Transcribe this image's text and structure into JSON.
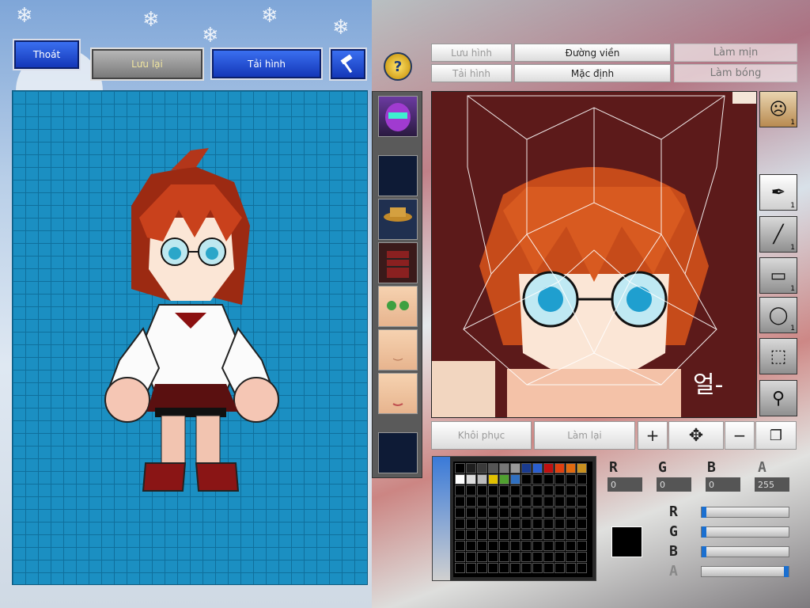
{
  "toolbar": {
    "exit_label": "Thoát",
    "save_label": "Lưu lại",
    "reload_label": "Tải hình",
    "hammer_icon": "hammer-icon",
    "help_icon": "help-icon"
  },
  "options": {
    "save_image": "Lưu hình",
    "load_image": "Tải hình",
    "outline": "Đường viền",
    "default": "Mặc định",
    "smooth": "Làm mịn",
    "shade": "Làm bóng"
  },
  "texture_text": "얼-",
  "tools": {
    "pen_count": "1",
    "line_count": "1",
    "rect_count": "1",
    "ellipse_count": "1",
    "avatar_count": "1"
  },
  "actions": {
    "restore": "Khôi phục",
    "redo": "Làm lại"
  },
  "color": {
    "r_label": "R",
    "g_label": "G",
    "b_label": "B",
    "a_label": "A",
    "r_value": "0",
    "g_value": "0",
    "b_value": "0",
    "a_value": "255",
    "current_color": "#000000",
    "sliders": {
      "r": 0,
      "g": 0,
      "b": 0,
      "a": 1
    }
  },
  "palette_colors": [
    "#000000",
    "#1e1e1e",
    "#3a3a3a",
    "#555555",
    "#777777",
    "#999999",
    "#1a3b8f",
    "#2b5fd0",
    "#c01010",
    "#e04010",
    "#e06a10",
    "#c89020",
    "#ffffff",
    "#dddddd",
    "#bbbbbb",
    "#e0c000",
    "#50a030",
    "#3070c0"
  ]
}
